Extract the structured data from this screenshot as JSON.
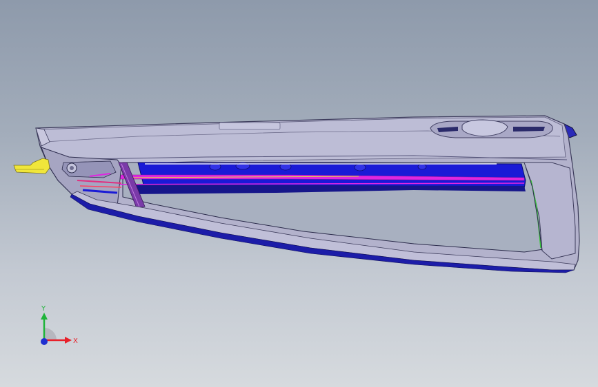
{
  "triad": {
    "x_label": "X",
    "y_label": "Y",
    "x_color": "#e8202a",
    "y_color": "#1fb43a",
    "z_color": "#1f2fd0"
  },
  "colors": {
    "background_top": "#8e9aab",
    "background_bottom": "#d6dade",
    "shell": "#b3b2cc",
    "shell_edge": "#3b3a5a",
    "inner_blue": "#1a1ad6",
    "magenta_rail": "#e026e0",
    "yellow_tab": "#f0e63a",
    "green_edge": "#39c43a",
    "dark_blue_trim": "#16168a"
  }
}
